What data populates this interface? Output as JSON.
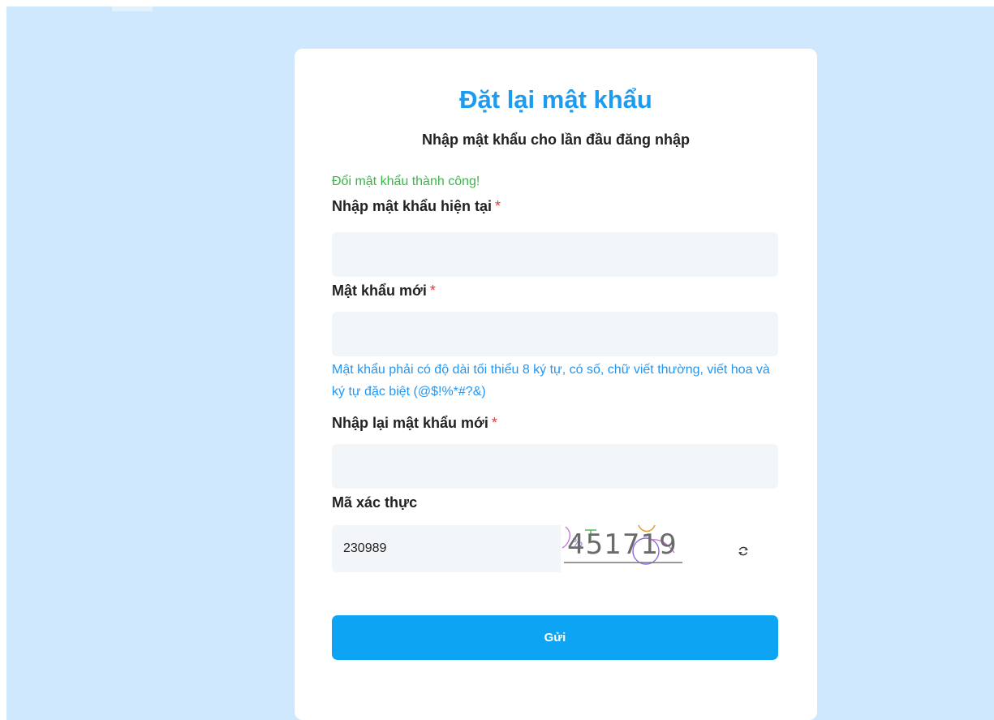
{
  "form": {
    "title": "Đặt lại mật khẩu",
    "subtitle": "Nhập mật khẩu cho lần đầu đăng nhập",
    "success_message": "Đổi mật khẩu thành công!",
    "required_mark": "*",
    "current_password": {
      "label": "Nhập mật khẩu hiện tại",
      "value": ""
    },
    "new_password": {
      "label": "Mật khẩu mới",
      "value": "",
      "hint": "Mật khẩu phải có độ dài tối thiểu 8 ký tự, có số, chữ viết thường, viết hoa và ký tự đặc biệt (@$!%*#?&)"
    },
    "confirm_password": {
      "label": "Nhập lại mật khẩu mới",
      "value": ""
    },
    "captcha": {
      "label": "Mã xác thực",
      "value": "230989",
      "image_text": "451719",
      "refresh_icon": "refresh-icon"
    },
    "submit_label": "Gửi"
  },
  "colors": {
    "background": "#cfe8fd",
    "accent": "#1d9bf0",
    "button": "#0ca4f3",
    "success": "#3cb54a",
    "required": "#e53935",
    "hint": "#2196f3"
  }
}
